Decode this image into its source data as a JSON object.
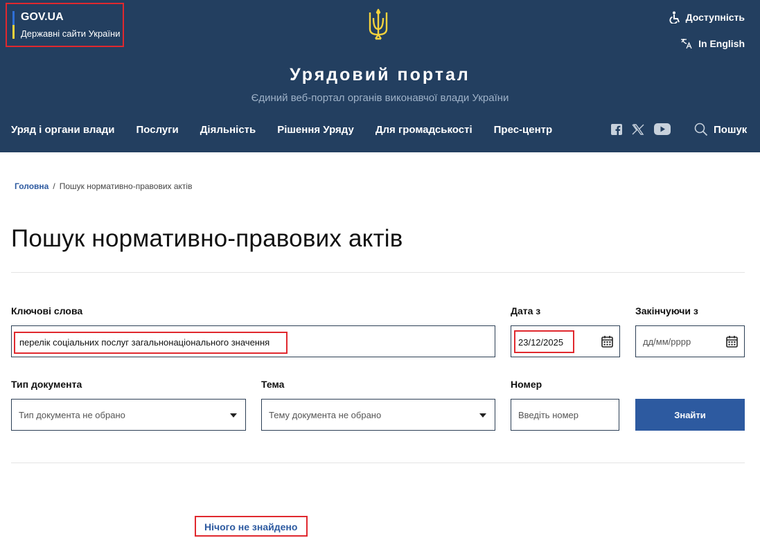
{
  "header": {
    "gov_title": "GOV.UA",
    "gov_subtitle": "Державні сайти України",
    "accessibility": "Доступність",
    "language": "In English",
    "portal_title": "Урядовий портал",
    "portal_subtitle": "Єдиний веб-портал органів виконавчої влади України",
    "search_label": "Пошук",
    "nav": [
      "Уряд і органи влади",
      "Послуги",
      "Діяльність",
      "Рішення Уряду",
      "Для громадськості",
      "Прес-центр"
    ]
  },
  "breadcrumb": {
    "home": "Головна",
    "separator": "/",
    "current": "Пошук нормативно-правових актів"
  },
  "page_title": "Пошук нормативно-правових актів",
  "form": {
    "keywords_label": "Ключові слова",
    "keywords_value": "перелік соціальних послуг загальнонаціонального значення",
    "date_from_label": "Дата з",
    "date_from_value": "23/12/2025",
    "date_to_label": "Закінчуючи з",
    "date_to_placeholder": "дд/мм/рррр",
    "doc_type_label": "Тип документа",
    "doc_type_value": "Тип документа не обрано",
    "topic_label": "Тема",
    "topic_value": "Тему документа не обрано",
    "number_label": "Номер",
    "number_placeholder": "Введіть номер",
    "find_button": "Знайти"
  },
  "result_message": "Нічого не знайдено",
  "colors": {
    "header_bg": "#233f60",
    "accent": "#2d5aa0",
    "highlight": "#e0282e",
    "trident": "#f5d33c"
  }
}
